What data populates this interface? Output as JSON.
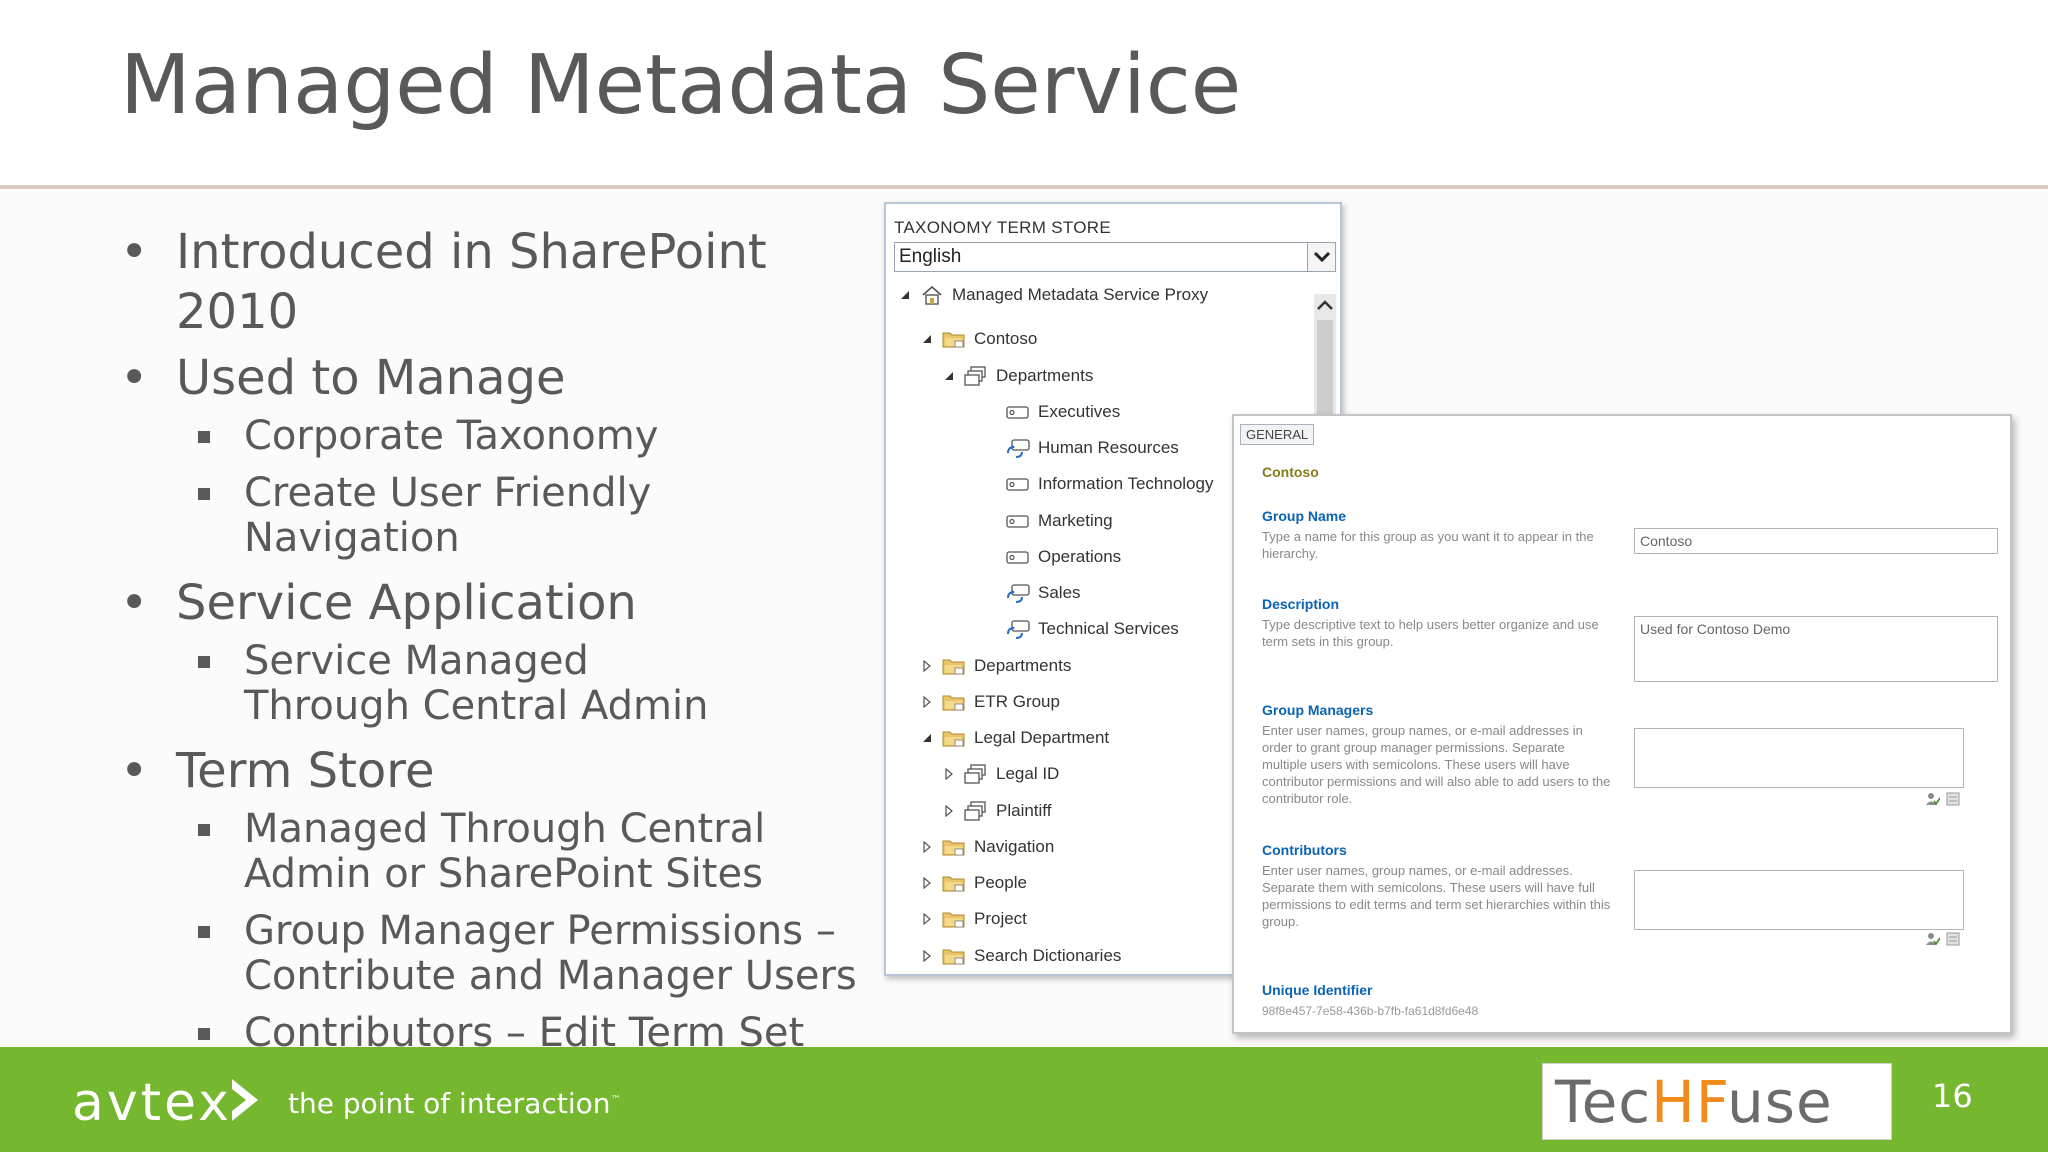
{
  "slide": {
    "title": "Managed Metadata Service",
    "page_number": "16"
  },
  "bullets": [
    {
      "text": "Introduced in SharePoint 2010",
      "children": []
    },
    {
      "text": "Used to Manage",
      "children": [
        "Corporate Taxonomy",
        "Create User Friendly Navigation"
      ]
    },
    {
      "text": "Service Application",
      "children": [
        "Service Managed Through Central Admin"
      ]
    },
    {
      "text": "Term Store",
      "children": [
        "Managed Through Central Admin or SharePoint Sites",
        "Group Manager Permissions – Contribute and Manager Users",
        "Contributors – Edit Term Set"
      ]
    }
  ],
  "term_store": {
    "header": "TAXONOMY TERM STORE",
    "language": "English",
    "tree": [
      {
        "label": "Managed Metadata Service Proxy",
        "icon": "home-icon",
        "arrow": "expanded"
      },
      {
        "label": "Contoso",
        "icon": "folder-icon",
        "arrow": "expanded"
      },
      {
        "label": "Departments",
        "icon": "termset-icon",
        "arrow": "expanded"
      },
      {
        "label": "Executives",
        "icon": "term-icon",
        "arrow": ""
      },
      {
        "label": "Human Resources",
        "icon": "term-reuse-icon",
        "arrow": ""
      },
      {
        "label": "Information Technology",
        "icon": "term-icon",
        "arrow": ""
      },
      {
        "label": "Marketing",
        "icon": "term-icon",
        "arrow": ""
      },
      {
        "label": "Operations",
        "icon": "term-icon",
        "arrow": ""
      },
      {
        "label": "Sales",
        "icon": "term-reuse-icon",
        "arrow": ""
      },
      {
        "label": "Technical Services",
        "icon": "term-reuse-icon",
        "arrow": ""
      },
      {
        "label": "Departments",
        "icon": "folder-icon",
        "arrow": "collapsed"
      },
      {
        "label": "ETR Group",
        "icon": "folder-icon",
        "arrow": "collapsed"
      },
      {
        "label": "Legal Department",
        "icon": "folder-icon",
        "arrow": "expanded"
      },
      {
        "label": "Legal ID",
        "icon": "termset-icon",
        "arrow": "collapsed"
      },
      {
        "label": "Plaintiff",
        "icon": "termset-icon",
        "arrow": "collapsed"
      },
      {
        "label": "Navigation",
        "icon": "folder-icon",
        "arrow": "collapsed"
      },
      {
        "label": "People",
        "icon": "folder-icon",
        "arrow": "collapsed"
      },
      {
        "label": "Project",
        "icon": "folder-icon",
        "arrow": "collapsed"
      },
      {
        "label": "Search Dictionaries",
        "icon": "folder-icon",
        "arrow": "collapsed"
      }
    ]
  },
  "general": {
    "tab": "GENERAL",
    "heading": "Contoso",
    "group_name": {
      "label": "Group Name",
      "desc": "Type a name for this group as you want it to appear in the hierarchy.",
      "value": "Contoso"
    },
    "description": {
      "label": "Description",
      "desc": "Type descriptive text to help users better organize and use term sets in this group.",
      "value": "Used for Contoso Demo"
    },
    "group_managers": {
      "label": "Group Managers",
      "desc": "Enter user names, group names, or e-mail addresses in order to grant group manager permissions. Separate multiple users with semicolons. These users will have contributor permissions and will also able to add users to the contributor role.",
      "value": ""
    },
    "contributors": {
      "label": "Contributors",
      "desc": "Enter user names, group names, or e-mail addresses. Separate them with semicolons. These users will have full permissions to edit terms and term set hierarchies within this group.",
      "value": ""
    },
    "unique_identifier": {
      "label": "Unique Identifier",
      "value": "98f8e457-7e58-436b-b7fb-fa61d8fd6e48"
    }
  },
  "footer": {
    "brand": "avtex",
    "tagline": "the point of interaction",
    "tm": "™",
    "partner_pre": "Tec",
    "partner_mid": "HF",
    "partner_post": "use"
  },
  "colors": {
    "footer_green": "#75b72e",
    "title_gray": "#595959",
    "label_blue": "#0a63b4",
    "techfuse_orange": "#f08b1c"
  }
}
